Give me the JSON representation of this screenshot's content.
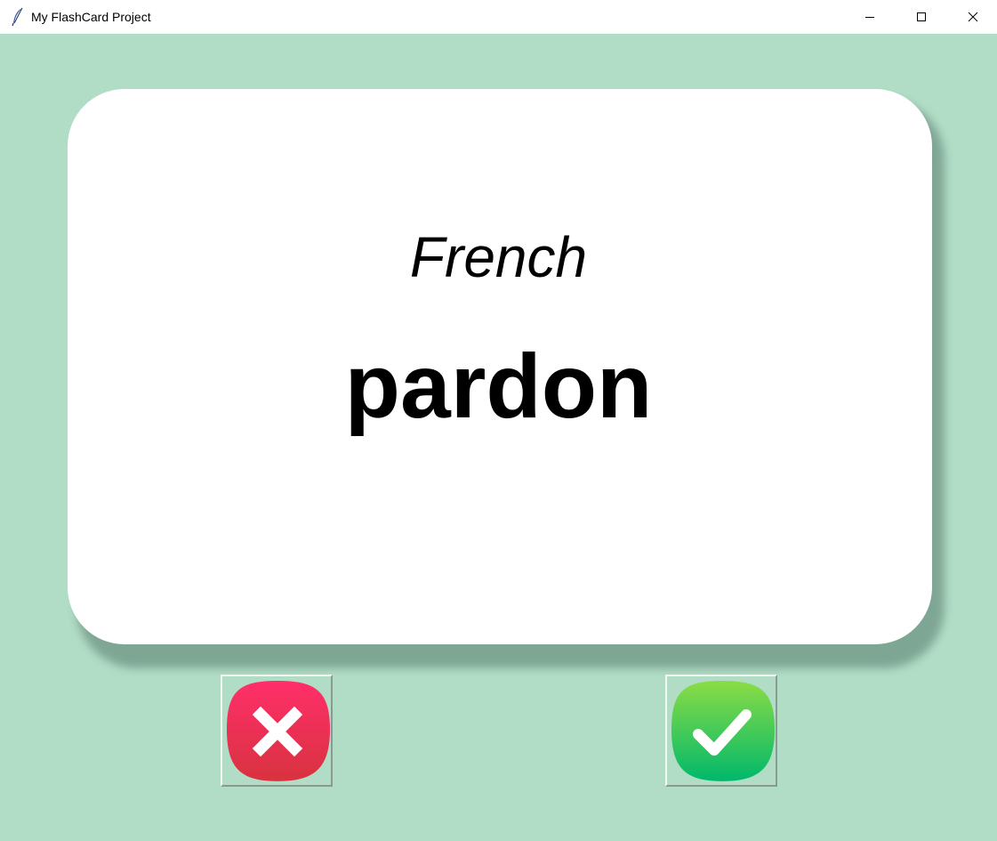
{
  "window": {
    "title": "My FlashCard Project"
  },
  "card": {
    "language": "French",
    "word": "pardon"
  },
  "buttons": {
    "wrong": {
      "icon": "x-icon"
    },
    "right": {
      "icon": "checkmark-icon"
    }
  },
  "colors": {
    "background": "#b1ddc6",
    "card": "#ffffff",
    "wrong": "#e9334e",
    "right": "#22c55e"
  }
}
